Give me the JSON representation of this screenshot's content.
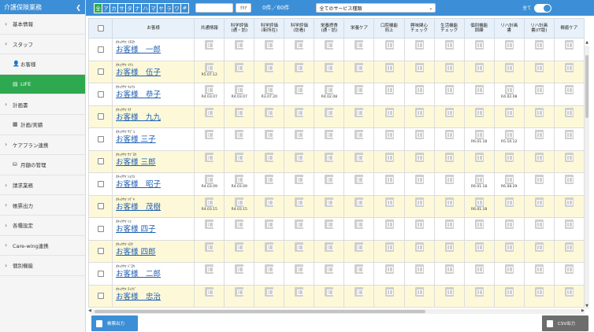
{
  "sidebar": {
    "title": "介護保険業務",
    "items": [
      {
        "label": "基本情報",
        "type": "group",
        "icon": "chevron-right-icon"
      },
      {
        "label": "スタッフ",
        "type": "group",
        "icon": "chevron-right-icon"
      },
      {
        "label": "お客様",
        "type": "sub",
        "icon": "person-icon"
      },
      {
        "label": "LIFE",
        "type": "sub",
        "icon": "document-icon",
        "active": true
      },
      {
        "label": "計画書",
        "type": "group",
        "icon": "chevron-right-icon"
      },
      {
        "label": "計画/実績",
        "type": "sub",
        "icon": "table-icon"
      },
      {
        "label": "ケアプラン連携",
        "type": "group",
        "icon": "chevron-right-icon"
      },
      {
        "label": "月額の管理",
        "type": "sub",
        "icon": "database-icon"
      },
      {
        "label": "請求業務",
        "type": "group",
        "icon": "chevron-right-icon"
      },
      {
        "label": "帳票出力",
        "type": "group",
        "icon": "chevron-right-icon"
      },
      {
        "label": "各種設定",
        "type": "group",
        "icon": "chevron-right-icon"
      },
      {
        "label": "Care-wing連携",
        "type": "group",
        "icon": "chevron-right-icon"
      },
      {
        "label": "個別機能",
        "type": "group",
        "icon": "chevron-right-icon"
      }
    ]
  },
  "toolbar": {
    "kana": [
      "全",
      "ア",
      "カ",
      "サ",
      "タ",
      "ナ",
      "ハ",
      "マ",
      "ヤ",
      "ラ",
      "ワ",
      "#"
    ],
    "search_value": "",
    "clear_label": "ｸﾘｱ",
    "count": "0件／60件",
    "service_select": "全てのサービス種類",
    "toggle_label": "全て"
  },
  "table": {
    "columns": [
      "お客様",
      "共通情報",
      "科学評価\n(通・訪)",
      "科学評価\n(新所在)",
      "科学評価\n(訪看)",
      "栄養摂食\n(通・訪)",
      "栄養ケア",
      "口腔機能\n向上",
      "興味関心\nチェック",
      "生活機能\nチェック",
      "個別機能\n訓練",
      "リハ計画\n書",
      "リハ計画\n書(IT版)",
      "褥瘡ケア"
    ],
    "rows": [
      {
        "kana": "ｵｷｬｸｻﾏ ｲﾁﾛｳ",
        "name": "お客様　一郎",
        "dates": [
          "",
          "",
          "",
          "",
          "",
          "",
          "",
          "",
          "",
          "",
          "",
          "",
          ""
        ]
      },
      {
        "kana": "ｵｷｬｸｻﾏ ｲｸｺ",
        "name": "お客様　伍子",
        "dates": [
          "R5.07.12",
          "",
          "",
          "",
          "",
          "",
          "",
          "",
          "",
          "",
          "",
          "",
          ""
        ]
      },
      {
        "kana": "ｵｷｬｸｻﾏ ｷｮｳｺ",
        "name": "お客様　恭子",
        "dates": [
          "R4.03.07",
          "R4.03.07",
          "R3.07.20",
          "",
          "R4.02.08",
          "",
          "",
          "",
          "",
          "",
          "R4.02.08",
          "",
          ""
        ]
      },
      {
        "kana": "ｵｷｬｸｻﾏ ｸｸ",
        "name": "お客様　九九",
        "dates": [
          "",
          "",
          "",
          "",
          "",
          "",
          "",
          "",
          "",
          "",
          "",
          "",
          ""
        ]
      },
      {
        "kana": "ｵｷｬｸｻﾏ ｻﾌﾞｺ",
        "name": "お客様 三子",
        "dates": [
          "",
          "",
          "",
          "",
          "",
          "",
          "",
          "",
          "",
          "R6.01.18",
          "R5.10.12",
          "",
          ""
        ]
      },
      {
        "kana": "ｵｷｬｸｻﾏ ｻﾌﾞﾛｳ",
        "name": "お客様 三郎",
        "dates": [
          "",
          "",
          "",
          "",
          "",
          "",
          "",
          "",
          "",
          "",
          "",
          "",
          ""
        ]
      },
      {
        "kana": "ｵｷｬｸｻﾏ ｼｮｳｺ",
        "name": "お客様　昭子",
        "dates": [
          "R4.03.09",
          "R4.03.09",
          "",
          "",
          "",
          "",
          "",
          "",
          "",
          "R6.01.18",
          "R6.08.29",
          "",
          ""
        ]
      },
      {
        "kana": "ｵｷｬｸｻﾏ ｼｹﾞｷ",
        "name": "お客様　茂樹",
        "dates": [
          "R4.03.15",
          "R4.03.15",
          "",
          "",
          "",
          "",
          "",
          "",
          "",
          "R6.01.18",
          "",
          "",
          ""
        ]
      },
      {
        "kana": "ｵｷｬｸｻﾏ ｼｺ",
        "name": "お客様 四子",
        "dates": [
          "",
          "",
          "",
          "",
          "",
          "",
          "",
          "",
          "",
          "",
          "",
          "",
          ""
        ]
      },
      {
        "kana": "ｵｷｬｸｻﾏ ｼﾛｳ",
        "name": "お客様 四郎",
        "dates": [
          "",
          "",
          "",
          "",
          "",
          "",
          "",
          "",
          "",
          "",
          "",
          "",
          ""
        ]
      },
      {
        "kana": "ｵｷｬｸｻﾏ ｼﾞﾛｳ",
        "name": "お客様　二郎",
        "dates": [
          "",
          "",
          "",
          "",
          "",
          "",
          "",
          "",
          "",
          "",
          "",
          "",
          ""
        ]
      },
      {
        "kana": "ｵｷｬｸｻﾏ ﾁｭｳｼﾞ",
        "name": "お客様　忠治",
        "dates": [
          "",
          "",
          "",
          "",
          "",
          "",
          "",
          "",
          "",
          "",
          "",
          "",
          ""
        ]
      }
    ]
  },
  "buttons": {
    "report": "帳票出力",
    "csv": "CSV出力"
  }
}
